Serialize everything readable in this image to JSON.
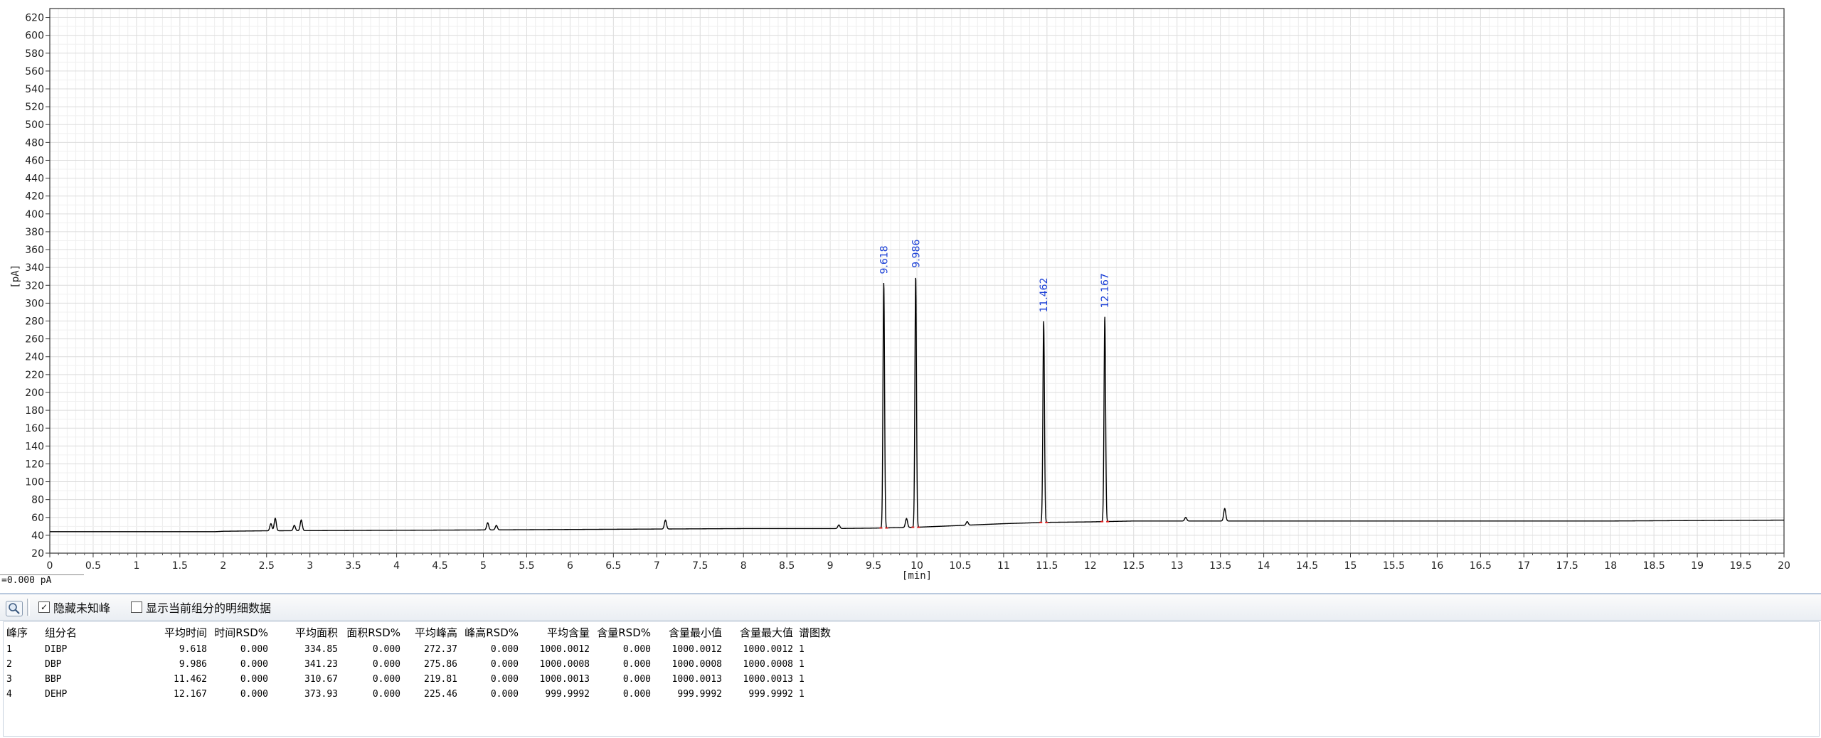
{
  "chart_data": {
    "type": "line",
    "xlabel": "[min]",
    "ylabel": "[pA]",
    "xlim": [
      0,
      20
    ],
    "ylim": [
      20,
      630
    ],
    "x_ticks": [
      "0",
      "0.5",
      "1",
      "1.5",
      "2",
      "2.5",
      "3",
      "3.5",
      "4",
      "4.5",
      "5",
      "5.5",
      "6",
      "6.5",
      "7",
      "7.5",
      "8",
      "8.5",
      "9",
      "9.5",
      "10",
      "10.5",
      "11",
      "11.5",
      "12",
      "12.5",
      "13",
      "13.5",
      "14",
      "14.5",
      "15",
      "15.5",
      "16",
      "16.5",
      "17",
      "17.5",
      "18",
      "18.5",
      "19",
      "19.5",
      "20"
    ],
    "y_ticks": [
      "20",
      "40",
      "60",
      "80",
      "100",
      "120",
      "140",
      "160",
      "180",
      "200",
      "220",
      "240",
      "260",
      "280",
      "300",
      "320",
      "340",
      "360",
      "380",
      "400",
      "420",
      "440",
      "460",
      "480",
      "500",
      "520",
      "540",
      "560",
      "580",
      "600",
      "620"
    ],
    "grid": true,
    "line_color": "#000000",
    "baseline": [
      [
        0,
        44
      ],
      [
        1.9,
        44
      ],
      [
        2.0,
        44.5
      ],
      [
        2.45,
        45
      ],
      [
        5.0,
        46
      ],
      [
        6.0,
        46.5
      ],
      [
        7.0,
        47
      ],
      [
        8.0,
        47.5
      ],
      [
        9.0,
        47.5
      ],
      [
        9.5,
        48
      ],
      [
        10.0,
        49
      ],
      [
        10.5,
        51
      ],
      [
        11.0,
        53
      ],
      [
        11.5,
        54.5
      ],
      [
        12.0,
        55
      ],
      [
        12.5,
        56
      ],
      [
        13.0,
        56
      ],
      [
        14.0,
        56
      ],
      [
        16.0,
        56
      ],
      [
        18.0,
        56
      ],
      [
        20,
        57
      ]
    ],
    "minor_peaks": [
      {
        "rt": 2.55,
        "height": 8
      },
      {
        "rt": 2.6,
        "height": 14
      },
      {
        "rt": 2.82,
        "height": 6
      },
      {
        "rt": 2.9,
        "height": 12
      },
      {
        "rt": 5.05,
        "height": 8
      },
      {
        "rt": 5.15,
        "height": 5
      },
      {
        "rt": 7.1,
        "height": 10
      },
      {
        "rt": 9.1,
        "height": 4
      },
      {
        "rt": 9.88,
        "height": 10
      },
      {
        "rt": 10.58,
        "height": 4
      },
      {
        "rt": 13.1,
        "height": 4
      },
      {
        "rt": 13.55,
        "height": 14
      }
    ],
    "peaks": [
      {
        "label": "9.618",
        "rt": 9.618,
        "apex": 323
      },
      {
        "label": "9.986",
        "rt": 9.986,
        "apex": 330
      },
      {
        "label": "11.462",
        "rt": 11.462,
        "apex": 280
      },
      {
        "label": "12.167",
        "rt": 12.167,
        "apex": 285
      }
    ]
  },
  "cursor_readout": "=0.000 pA",
  "toolbar": {
    "zoom_icon": "magnifier-icon",
    "hide_unknown_label": "隐藏未知峰",
    "hide_unknown_checked": true,
    "show_detail_label": "显示当前组分的明细数据",
    "show_detail_checked": false
  },
  "table": {
    "headers": [
      "峰序",
      "组分名",
      "平均时间",
      "时间RSD%",
      "平均面积",
      "面积RSD%",
      "平均峰高",
      "峰高RSD%",
      "平均含量",
      "含量RSD%",
      "含量最小值",
      "含量最大值",
      "谱图数"
    ],
    "rows": [
      [
        "1",
        "DIBP",
        "9.618",
        "0.000",
        "334.85",
        "0.000",
        "272.37",
        "0.000",
        "1000.0012",
        "0.000",
        "1000.0012",
        "1000.0012",
        "1"
      ],
      [
        "2",
        "DBP",
        "9.986",
        "0.000",
        "341.23",
        "0.000",
        "275.86",
        "0.000",
        "1000.0008",
        "0.000",
        "1000.0008",
        "1000.0008",
        "1"
      ],
      [
        "3",
        "BBP",
        "11.462",
        "0.000",
        "310.67",
        "0.000",
        "219.81",
        "0.000",
        "1000.0013",
        "0.000",
        "1000.0013",
        "1000.0013",
        "1"
      ],
      [
        "4",
        "DEHP",
        "12.167",
        "0.000",
        "373.93",
        "0.000",
        "225.46",
        "0.000",
        "999.9992",
        "0.000",
        "999.9992",
        "999.9992",
        "1"
      ]
    ]
  }
}
